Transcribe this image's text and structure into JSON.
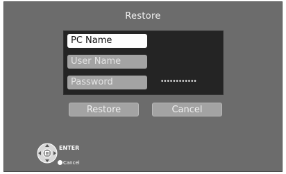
{
  "dialog": {
    "title": "Restore"
  },
  "form": {
    "pc_name_label": "PC Name",
    "user_name_label": "User Name",
    "password_label": "Password",
    "password_value": "••••••••••••"
  },
  "buttons": {
    "restore_label": "Restore",
    "cancel_label": "Cancel"
  },
  "legend": {
    "enter_label": "ENTER",
    "cancel_label": "Cancel",
    "icons": [
      "remote-dpad-icon",
      "cancel-button-icon"
    ]
  },
  "colors": {
    "background": "#6c6c6c",
    "panel": "#242424",
    "field_active": "#fefefe",
    "field_inactive": "#a3a3a3",
    "text_light": "#f2f2f2"
  }
}
